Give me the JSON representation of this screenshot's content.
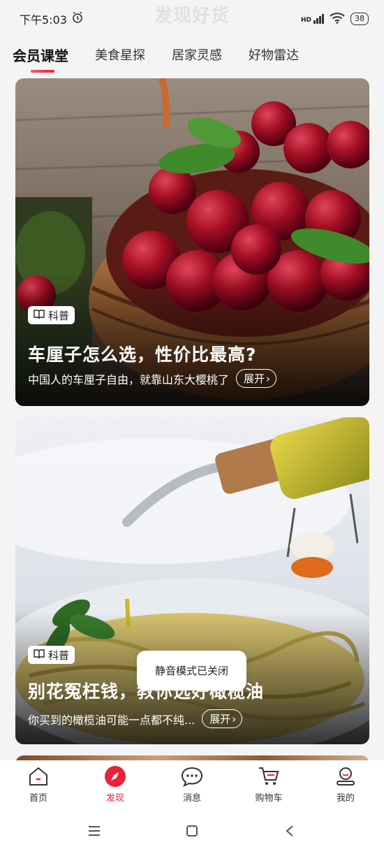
{
  "status": {
    "time": "下午5:03",
    "network": "HD",
    "battery": "38",
    "page_title_watermark": "发现好货"
  },
  "tabs": [
    {
      "label": "会员课堂",
      "active": true
    },
    {
      "label": "美食星探",
      "active": false
    },
    {
      "label": "居家灵感",
      "active": false
    },
    {
      "label": "好物雷达",
      "active": false
    }
  ],
  "cards": [
    {
      "tag": "科普",
      "title": "车厘子怎么选，性价比最高?",
      "subtitle": "中国人的车厘子自由，就靠山东大樱桃了",
      "expand": "展开"
    },
    {
      "tag": "科普",
      "title": "别花冤枉钱，教你选好橄榄油",
      "subtitle": "你买到的橄榄油可能一点都不纯...",
      "expand": "展开"
    }
  ],
  "toast": "静音模式已关闭",
  "bottom_nav": [
    {
      "label": "首页",
      "icon": "home-icon"
    },
    {
      "label": "发现",
      "icon": "compass-icon",
      "active": true
    },
    {
      "label": "消息",
      "icon": "message-icon"
    },
    {
      "label": "购物车",
      "icon": "cart-icon"
    },
    {
      "label": "我的",
      "icon": "profile-icon"
    }
  ],
  "colors": {
    "accent": "#e8223a",
    "background": "#f4f4f4"
  }
}
